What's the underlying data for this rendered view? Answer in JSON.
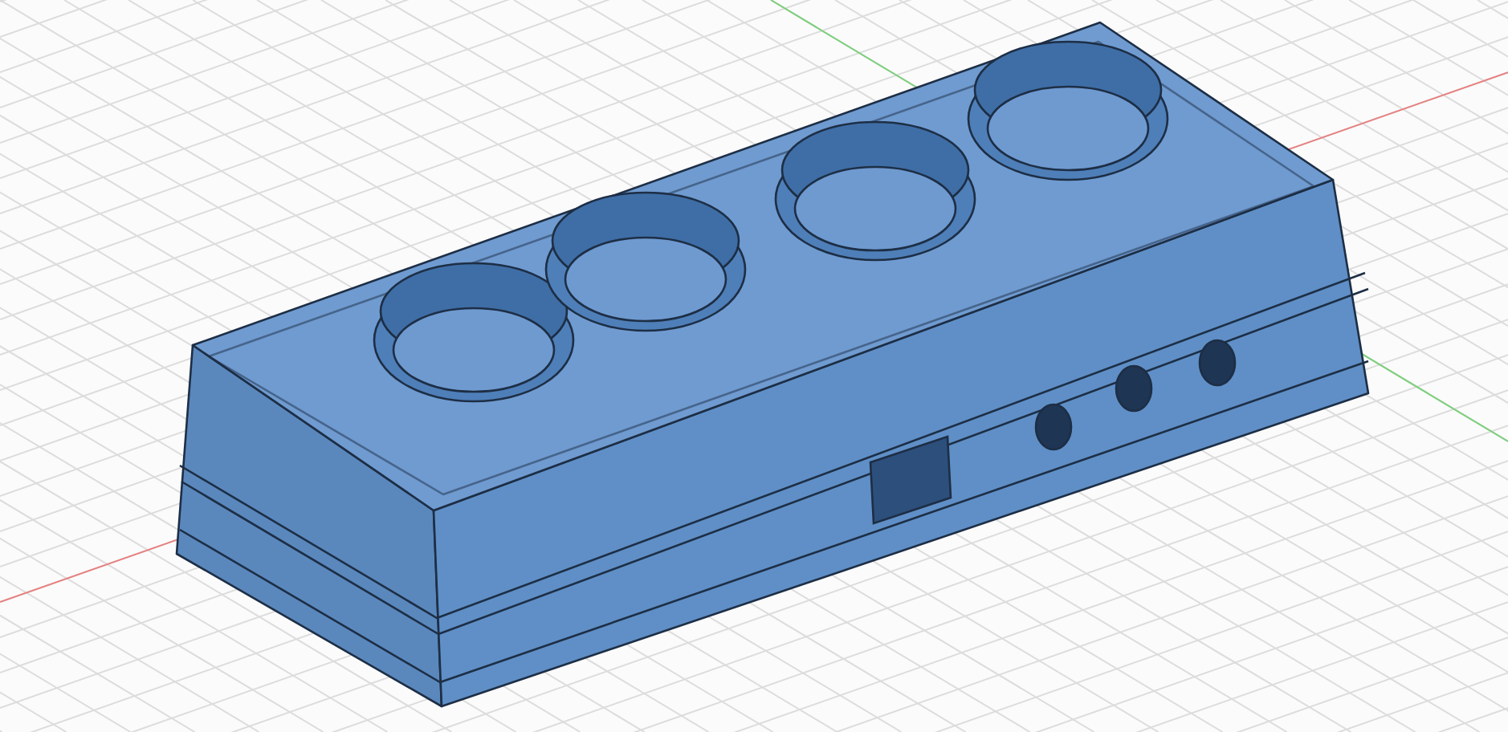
{
  "viewport": {
    "grid": true,
    "axes": true
  },
  "model": {
    "openings": [
      {
        "kind": "round"
      },
      {
        "kind": "round"
      },
      {
        "kind": "round"
      },
      {
        "kind": "round"
      }
    ],
    "ports": [
      {
        "kind": "square"
      },
      {
        "kind": "jack"
      },
      {
        "kind": "jack"
      },
      {
        "kind": "jack"
      }
    ]
  }
}
